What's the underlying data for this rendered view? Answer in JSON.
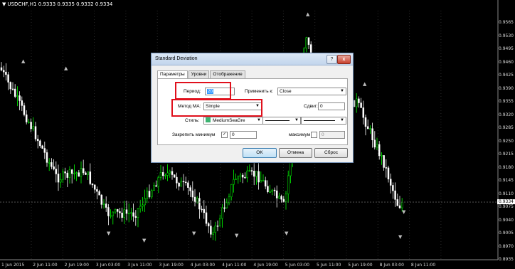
{
  "chart": {
    "symbol": "USDCHF,H1",
    "ohlc": "0.9333 0.9335 0.9332 0.9334",
    "current_price": "0.9334",
    "price_labels": [
      "0.9565",
      "0.9530",
      "0.9495",
      "0.9460",
      "0.9425",
      "0.9390",
      "0.9355",
      "0.9320",
      "0.9285",
      "0.9250",
      "0.9215",
      "0.9180",
      "0.9145",
      "0.9110",
      "0.9075",
      "0.9040",
      "0.9005",
      "0.8970",
      "0.8935"
    ],
    "time_labels": [
      "1 Jun 2015",
      "2 Jun 11:00",
      "2 Jun 19:00",
      "3 Jun 03:00",
      "3 Jun 11:00",
      "3 Jun 19:00",
      "4 Jun 03:00",
      "4 Jun 11:00",
      "4 Jun 19:00",
      "5 Jun 03:00",
      "5 Jun 11:00",
      "5 Jun 19:00",
      "8 Jun 03:00",
      "8 Jun 11:00"
    ],
    "colors": {
      "bull": "#00ff00",
      "bear": "#ffffff",
      "grid": "#2a2a2a",
      "indicator": "#3cb371"
    }
  },
  "dialog": {
    "title": "Standard Deviation",
    "help": "?",
    "close": "x",
    "tabs": [
      "Параметры",
      "Уровни",
      "Отображение"
    ],
    "period_label": "Период:",
    "period_value": "20",
    "apply_label": "Применить к:",
    "apply_value": "Close",
    "shift_label": "Сдвиг:",
    "shift_value": "0",
    "method_label": "Метод МА:",
    "method_value": "Simple",
    "style_label": "Стиль:",
    "style_color": "MediumSeaGre",
    "min_label": "Закрепить минимум",
    "min_value": "0",
    "max_label": "максимум",
    "max_value": "0",
    "ok": "OK",
    "cancel": "Отмена",
    "reset": "Сброс"
  }
}
